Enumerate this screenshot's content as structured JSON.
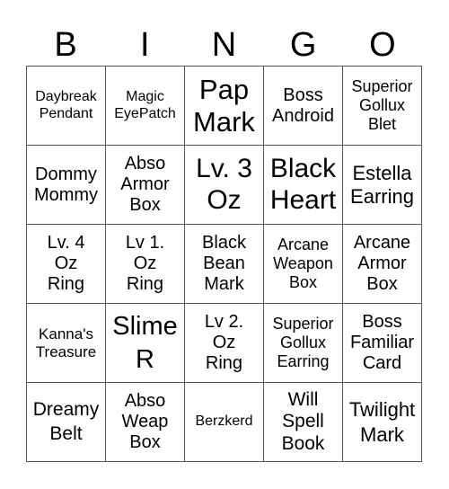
{
  "header": [
    "B",
    "I",
    "N",
    "G",
    "O"
  ],
  "cells": [
    "Daybreak\nPendant",
    "Magic\nEyePatch",
    "Pap\nMark",
    "Boss\nAndroid",
    "Superior\nGollux\nBlet",
    "Dommy\nMommy",
    "Abso\nArmor\nBox",
    "Lv. 3\nOz",
    "Black\nHeart",
    "Estella\nEarring",
    "Lv. 4\nOz\nRing",
    "Lv 1.\nOz\nRing",
    "Black\nBean\nMark",
    "Arcane\nWeapon\nBox",
    "Arcane\nArmor\nBox",
    "Kanna's\nTreasure",
    "Slime\nR",
    "Lv 2.\nOz\nRing",
    "Superior\nGollux\nEarring",
    "Boss\nFamiliar\nCard",
    "Dreamy\nBelt",
    "Abso\nWeap\nBox",
    "Berzkerd",
    "Will\nSpell\nBook",
    "Twilight\nMark"
  ]
}
